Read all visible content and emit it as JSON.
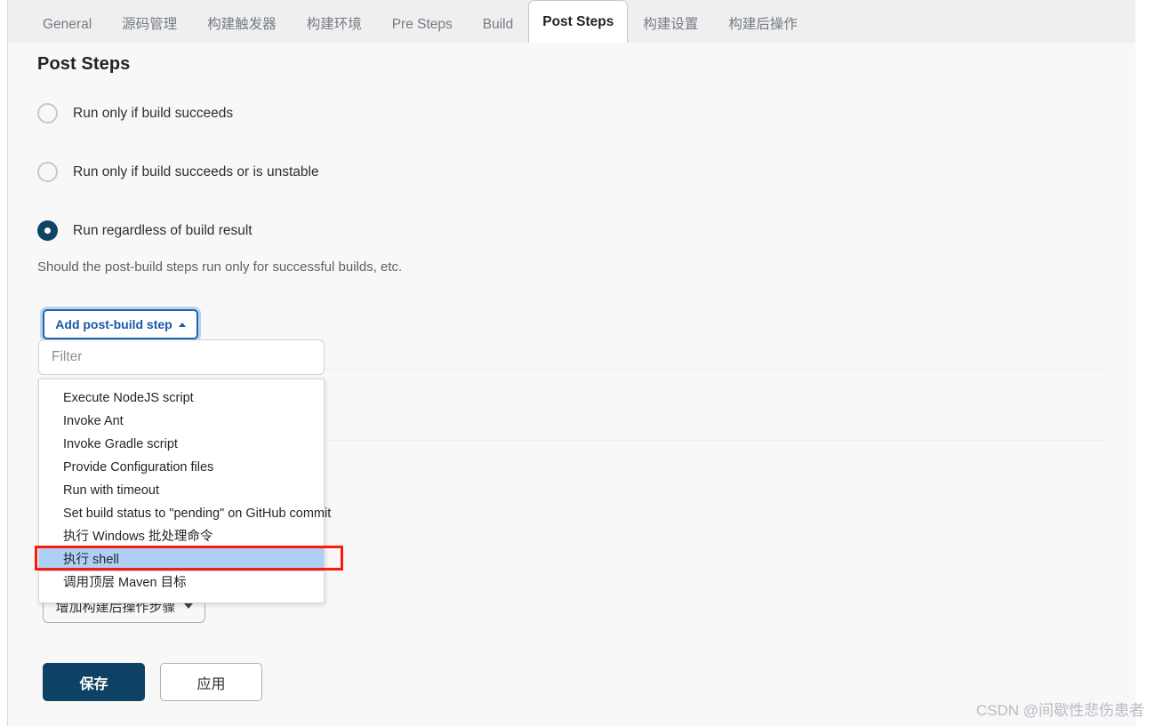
{
  "tabs": [
    {
      "label": "General",
      "active": false
    },
    {
      "label": "源码管理",
      "active": false
    },
    {
      "label": "构建触发器",
      "active": false
    },
    {
      "label": "构建环境",
      "active": false
    },
    {
      "label": "Pre Steps",
      "active": false
    },
    {
      "label": "Build",
      "active": false
    },
    {
      "label": "Post Steps",
      "active": true
    },
    {
      "label": "构建设置",
      "active": false
    },
    {
      "label": "构建后操作",
      "active": false
    }
  ],
  "section": {
    "title": "Post Steps",
    "helper_text": "Should the post-build steps run only for successful builds, etc."
  },
  "radios": [
    {
      "label": "Run only if build succeeds",
      "checked": false
    },
    {
      "label": "Run only if build succeeds or is unstable",
      "checked": false
    },
    {
      "label": "Run regardless of build result",
      "checked": true
    }
  ],
  "add_step": {
    "label": "Add post-build step",
    "caret_icon": "caret-up-icon"
  },
  "filter": {
    "value": "",
    "placeholder": "Filter"
  },
  "dropdown": {
    "items": [
      {
        "label": "Execute NodeJS script",
        "highlighted": false
      },
      {
        "label": "Invoke Ant",
        "highlighted": false
      },
      {
        "label": "Invoke Gradle script",
        "highlighted": false
      },
      {
        "label": "Provide Configuration files",
        "highlighted": false
      },
      {
        "label": "Run with timeout",
        "highlighted": false
      },
      {
        "label": "Set build status to \"pending\" on GitHub commit",
        "highlighted": false
      },
      {
        "label": "执行 Windows 批处理命令",
        "highlighted": false
      },
      {
        "label": "执行 shell",
        "highlighted": true
      },
      {
        "label": "调用顶层 Maven 目标",
        "highlighted": false
      }
    ]
  },
  "add_post_action": {
    "label": "增加构建后操作步骤",
    "caret_icon": "caret-down-icon"
  },
  "footer": {
    "save_label": "保存",
    "apply_label": "应用"
  },
  "watermark": {
    "text": "CSDN @间歇性悲伤患者"
  },
  "colors": {
    "accent_blue": "#1559a6",
    "navy": "#0e4265",
    "highlight": "#aed0f7",
    "annotation_red": "#f91c08",
    "tabbar_bg": "#efeff0",
    "content_bg": "#f8f8f8"
  }
}
